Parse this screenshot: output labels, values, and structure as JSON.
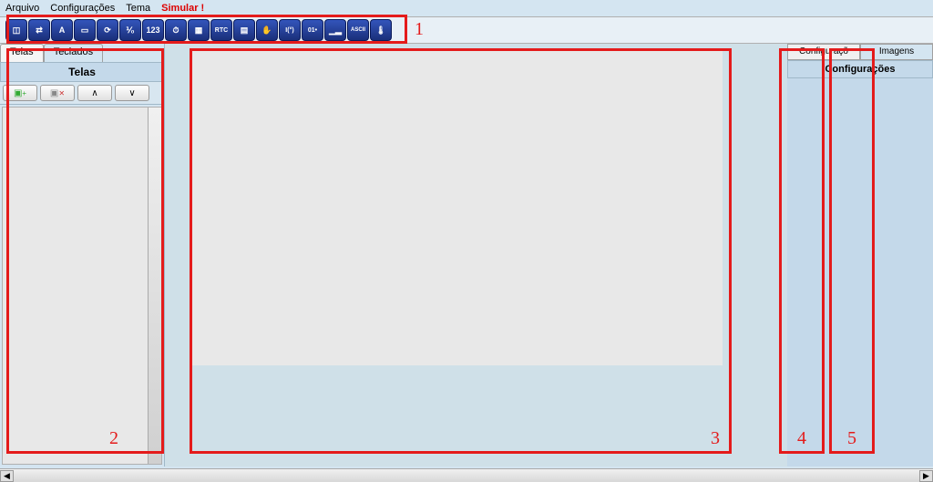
{
  "menu": {
    "arquivo": "Arquivo",
    "configuracoes": "Configurações",
    "tema": "Tema",
    "simular": "Simular !"
  },
  "toolbar_icons": [
    "◫",
    "⇄",
    "A",
    "▭",
    "⟳",
    "⅟₀",
    "123",
    "⏱",
    "▦",
    "RTC",
    "▤",
    "✋",
    "I(°)",
    "01•",
    "▁▂",
    "ASCII",
    "🌡"
  ],
  "left_panel": {
    "tabs": {
      "telas": "Telas",
      "teclados": "Teclados"
    },
    "header": "Telas",
    "btn_add": "+",
    "btn_del": "−",
    "btn_up": "∧",
    "btn_down": "∨"
  },
  "right_panel": {
    "tabs": {
      "config": "Configuraçõ",
      "imagens": "Imagens"
    },
    "header": "Configurações"
  },
  "annotations": {
    "a1": "1",
    "a2": "2",
    "a3": "3",
    "a4": "4",
    "a5": "5"
  }
}
